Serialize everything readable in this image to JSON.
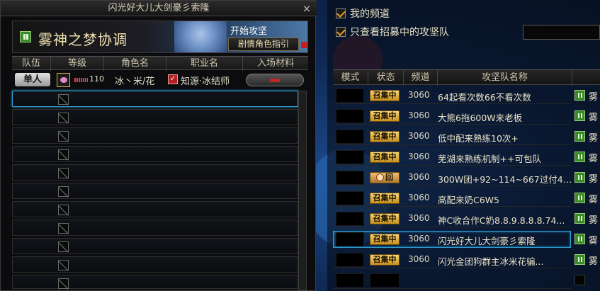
{
  "left_panel": {
    "title": "闪光好大儿大剑豪彡索隆",
    "close_label": "×",
    "banner": {
      "title": "雾神之梦协调",
      "start_text": "开始攻坚",
      "guide_button": "剧情角色指引"
    },
    "columns": [
      "队伍",
      "等级",
      "角色名",
      "职业名",
      "入场材料"
    ],
    "player": {
      "team_label": "单人",
      "level": "110",
      "name": "冰丶米/花",
      "job": "知源·冰结师",
      "material_placeholder": "-"
    },
    "empty_slot_count": 11
  },
  "right_panel": {
    "filter_my_channel": "我的频道",
    "filter_recruiting": "只查看招募中的攻坚队",
    "columns": [
      "模式",
      "状态",
      "频道",
      "攻坚队名称"
    ],
    "raids": [
      {
        "status": "召集中",
        "channel": "3060",
        "name": "64起看次数66不看次数",
        "extra": "雾",
        "joinable": true
      },
      {
        "status": "召集中",
        "channel": "3060",
        "name": "大熊6拖600W来老板",
        "extra": "雾",
        "joinable": true
      },
      {
        "status": "召集中",
        "channel": "3060",
        "name": "低中配来熟练10次+",
        "extra": "雾",
        "joinable": true
      },
      {
        "status": "召集中",
        "channel": "3060",
        "name": "芜湖来熟练机制++可包队",
        "extra": "雾",
        "joinable": true
      },
      {
        "status": "回",
        "channel": "3060",
        "name": "300W团+92~114~667过付40...",
        "extra": "雾",
        "joinable": true
      },
      {
        "status": "召集中",
        "channel": "3060",
        "name": "高配来奶C6W5",
        "extra": "雾",
        "joinable": true
      },
      {
        "status": "召集中",
        "channel": "3060",
        "name": "神C收合作C奶8.8.9.8.8.8.74...",
        "extra": "雾",
        "joinable": true
      },
      {
        "status": "召集中",
        "channel": "3060",
        "name": "闪光好大儿大剑豪彡索隆",
        "extra": "雾",
        "joinable": true,
        "selected": true
      },
      {
        "status": "召集中",
        "channel": "3060",
        "name": "闪光金团狗群主冰米花骗...",
        "extra": "雾",
        "joinable": true
      },
      {
        "status": "",
        "channel": "",
        "name": "",
        "extra": "",
        "joinable": false
      }
    ]
  },
  "colors": {
    "accent_selected": "#2c9fd4",
    "badge_gold": "#e8b840",
    "join_green": "#3a8a2a"
  }
}
